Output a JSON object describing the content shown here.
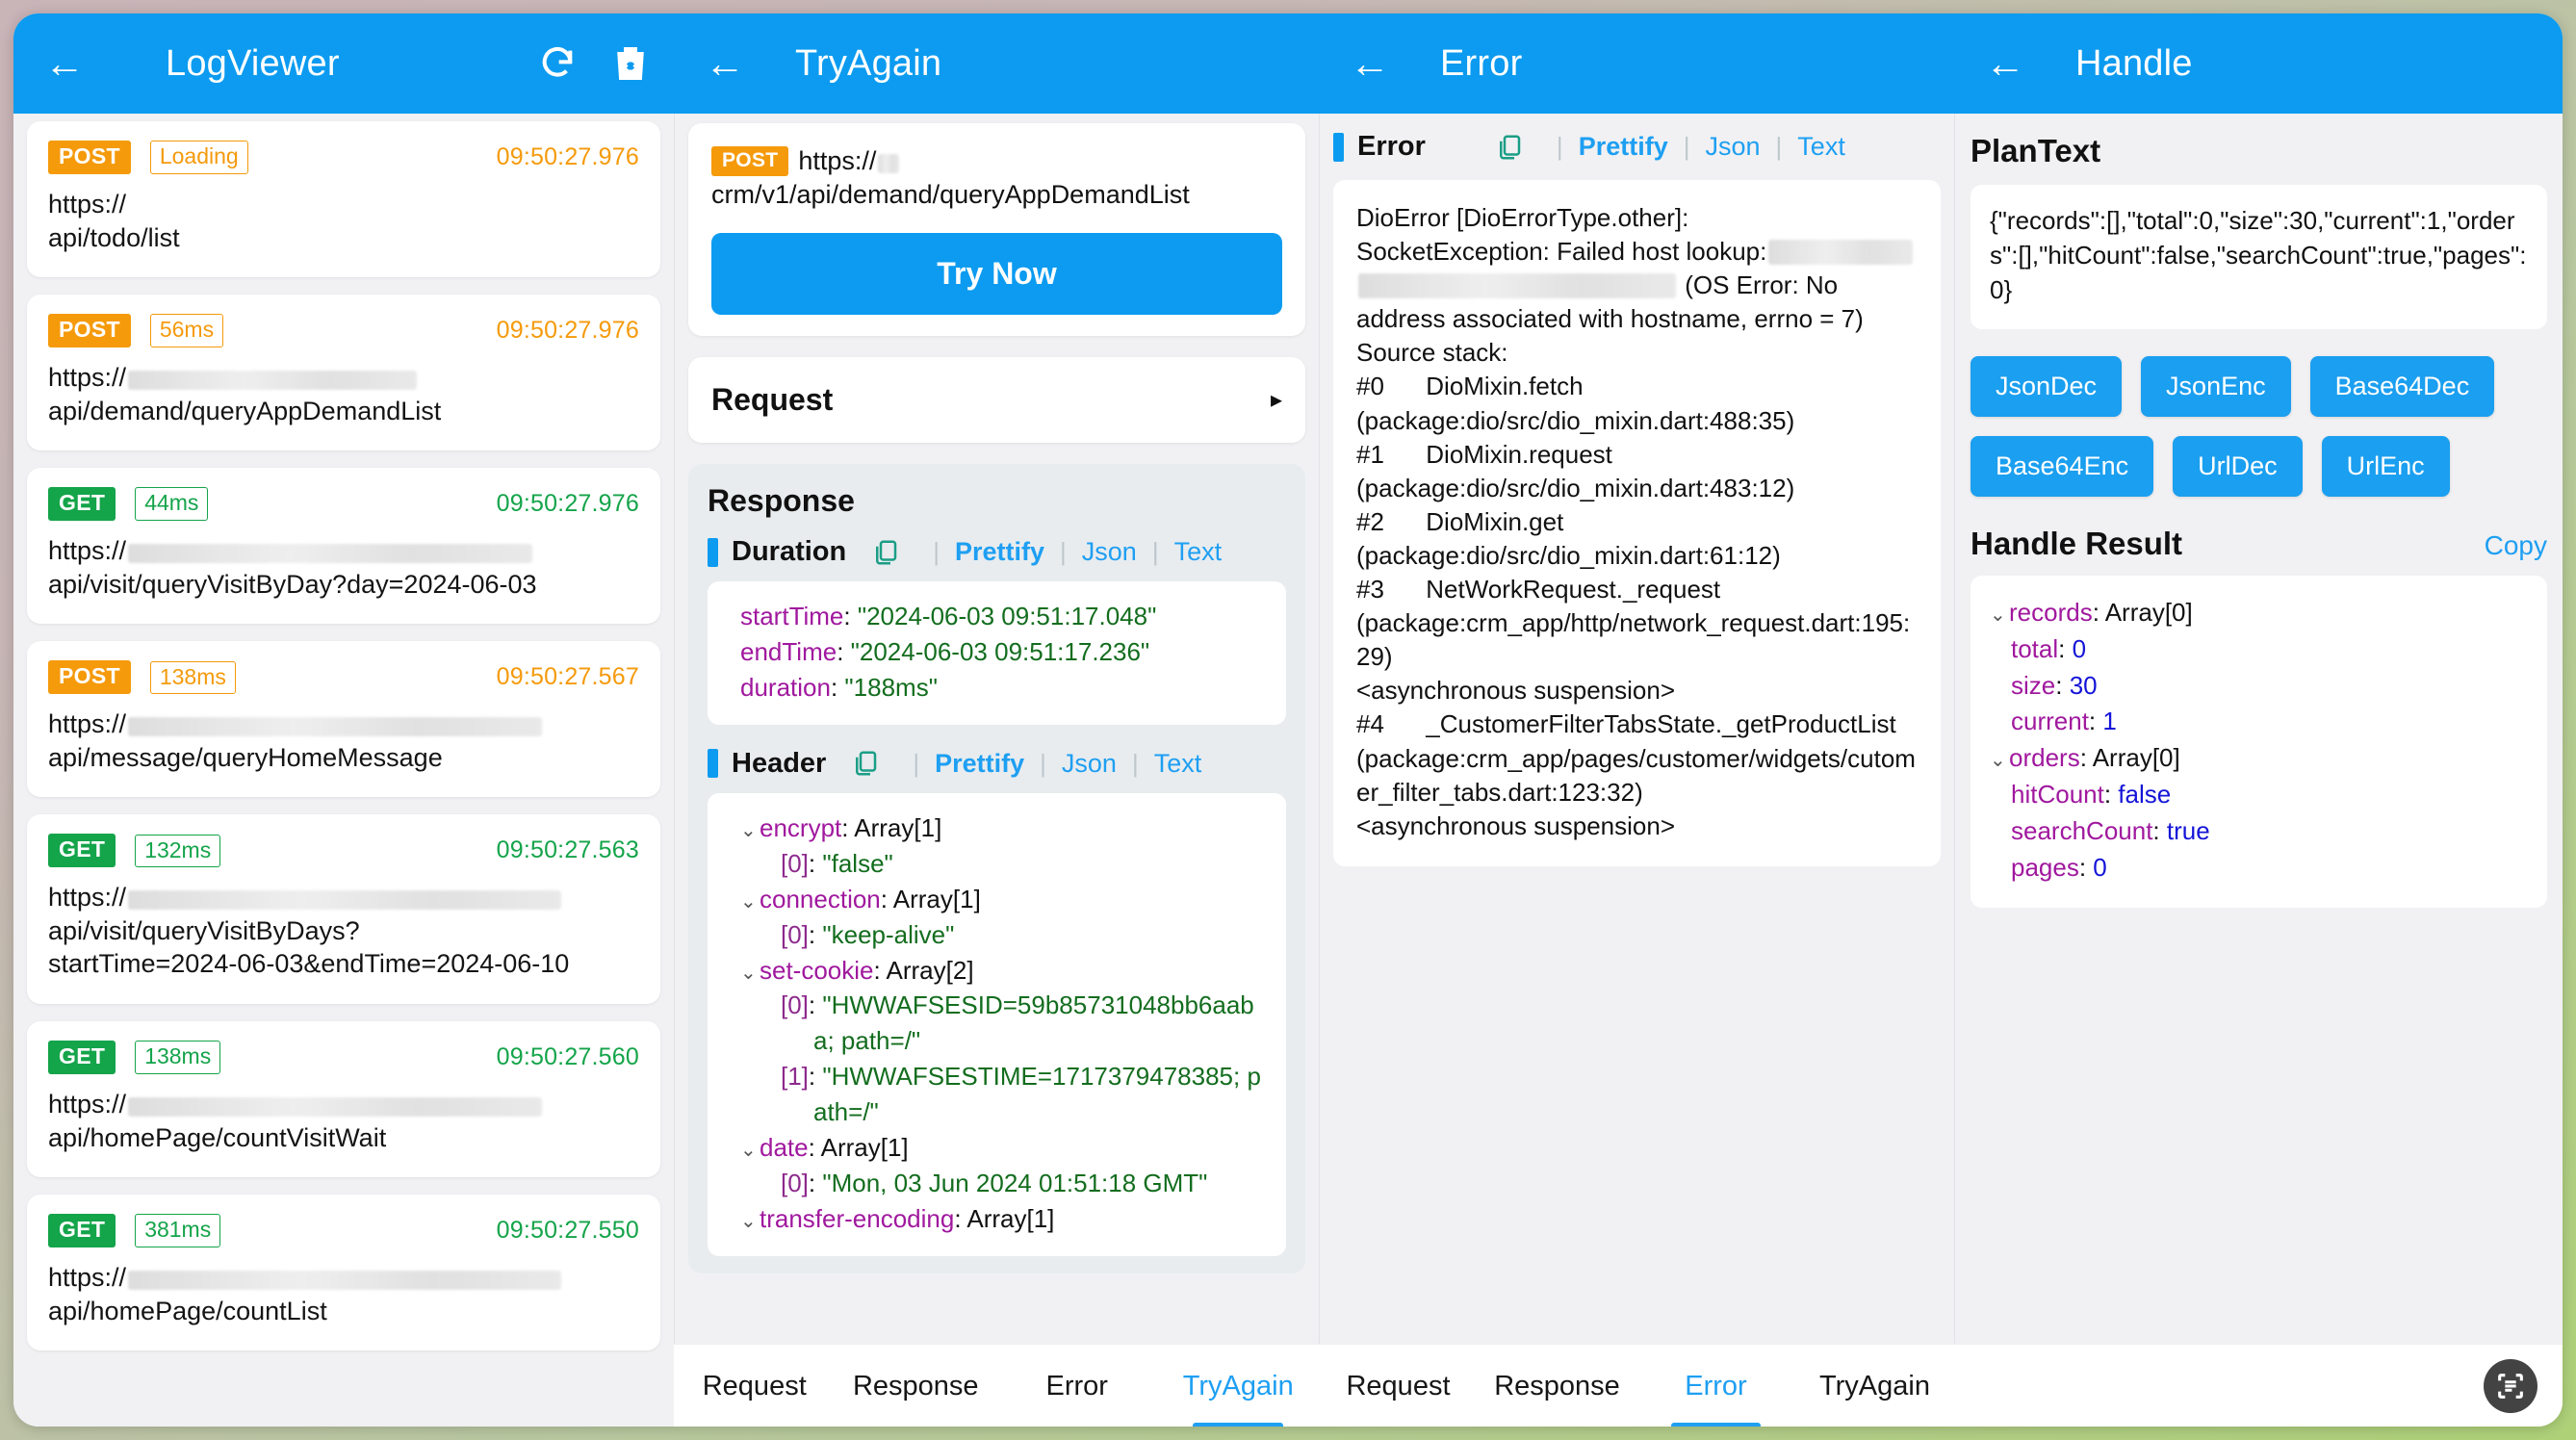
{
  "panels": {
    "logviewer": {
      "title": "LogViewer",
      "back_icon": "back-arrow-icon",
      "refresh_icon": "refresh-icon",
      "delete_icon": "delete-icon",
      "logs": [
        {
          "method": "POST",
          "kind": "post",
          "chip": "Loading",
          "time": "09:50:27.976",
          "url_prefix": "https://",
          "redact_w": 0,
          "url_rest": "api/todo/list",
          "lines": [
            "https://",
            "api/todo/list"
          ]
        },
        {
          "method": "POST",
          "kind": "post",
          "chip": "56ms",
          "time": "09:50:27.976",
          "url_prefix": "https://",
          "redact_w": 300,
          "url_rest": "api/demand/queryAppDemandList",
          "lines": [
            "https://",
            "api/demand/queryAppDemandList"
          ]
        },
        {
          "method": "GET",
          "kind": "get",
          "chip": "44ms",
          "time": "09:50:27.976",
          "url_prefix": "https://",
          "redact_w": 420,
          "url_rest": "api/visit/queryVisitByDay?day=2024-06-03",
          "lines": [
            "https://",
            "api/visit/queryVisitByDay?day=2024-06-03"
          ]
        },
        {
          "method": "POST",
          "kind": "post",
          "chip": "138ms",
          "time": "09:50:27.567",
          "url_prefix": "https://",
          "redact_w": 430,
          "url_rest": "api/message/queryHomeMessage",
          "lines": [
            "https://",
            "api/message/queryHomeMessage"
          ]
        },
        {
          "method": "GET",
          "kind": "get",
          "chip": "132ms",
          "time": "09:50:27.563",
          "url_prefix": "https://",
          "redact_w": 450,
          "url_rest": "api/visit/queryVisitByDays?startTime=2024-06-03&endTime=2024-06-10",
          "lines": [
            "https://",
            "api/visit/queryVisitByDays?",
            "startTime=2024-06-03&endTime=2024-06-10"
          ]
        },
        {
          "method": "GET",
          "kind": "get",
          "chip": "138ms",
          "time": "09:50:27.560",
          "url_prefix": "https://",
          "redact_w": 430,
          "url_rest": "api/homePage/countVisitWait",
          "lines": [
            "https://",
            "api/homePage/countVisitWait"
          ]
        },
        {
          "method": "GET",
          "kind": "get",
          "chip": "381ms",
          "time": "09:50:27.550",
          "url_prefix": "https://",
          "redact_w": 450,
          "url_rest": "api/homePage/countList",
          "lines": [
            "https://",
            "api/homePage/countList"
          ]
        }
      ]
    },
    "tryagain": {
      "title": "TryAgain",
      "request_method": "POST",
      "request_url_head": "https://",
      "request_url_tail": "crm/v1/api/demand/queryAppDemandList",
      "try_button": "Try Now",
      "request_row": "Request",
      "response_title": "Response",
      "duration_label": "Duration",
      "header_label": "Header",
      "actions": {
        "prettify": "Prettify",
        "json": "Json",
        "text": "Text"
      },
      "duration": {
        "startTime_key": "startTime",
        "startTime_val": "\"2024-06-03 09:51:17.048\"",
        "endTime_key": "endTime",
        "endTime_val": "\"2024-06-03 09:51:17.236\"",
        "duration_key": "duration",
        "duration_val": "\"188ms\""
      },
      "header_tree": [
        {
          "indent": 0,
          "arrow": true,
          "key": "encrypt",
          "type": "Array<String>[1]"
        },
        {
          "indent": 1,
          "arrow": false,
          "key": "[0]",
          "value": "\"false\""
        },
        {
          "indent": 0,
          "arrow": true,
          "key": "connection",
          "type": "Array<String>[1]"
        },
        {
          "indent": 1,
          "arrow": false,
          "key": "[0]",
          "value": "\"keep-alive\""
        },
        {
          "indent": 0,
          "arrow": true,
          "key": "set-cookie",
          "type": "Array<String>[2]"
        },
        {
          "indent": 1,
          "arrow": false,
          "key": "[0]",
          "value": "\"HWWAFSESID=59b85731048bb6aaba; path=/\""
        },
        {
          "indent": 1,
          "arrow": false,
          "key": "[1]",
          "value": "\"HWWAFSESTIME=1717379478385; path=/\""
        },
        {
          "indent": 0,
          "arrow": true,
          "key": "date",
          "type": "Array<String>[1]"
        },
        {
          "indent": 1,
          "arrow": false,
          "key": "[0]",
          "value": "\"Mon, 03 Jun 2024 01:51:18 GMT\""
        },
        {
          "indent": 0,
          "arrow": true,
          "key": "transfer-encoding",
          "type": "Array<String>[1]"
        }
      ]
    },
    "error": {
      "title": "Error",
      "section_label": "Error",
      "actions": {
        "prettify": "Prettify",
        "json": "Json",
        "text": "Text"
      },
      "text_1": "DioError [DioErrorType.other]:\nSocketException: Failed host lookup:",
      "text_2": "(OS Error: No address associated with hostname, errno = 7)\nSource stack:\n#0      DioMixin.fetch (package:dio/src/dio_mixin.dart:488:35)\n#1      DioMixin.request (package:dio/src/dio_mixin.dart:483:12)\n#2      DioMixin.get (package:dio/src/dio_mixin.dart:61:12)\n#3      NetWorkRequest._request (package:crm_app/http/network_request.dart:195:29)\n<asynchronous suspension>\n#4      _CustomerFilterTabsState._getProductList (package:crm_app/pages/customer/widgets/cutomer_filter_tabs.dart:123:32)\n<asynchronous suspension>"
    },
    "handle": {
      "title": "Handle",
      "plaintext_label": "PlanText",
      "plaintext_value": "{\"records\":[],\"total\":0,\"size\":30,\"current\":1,\"orders\":[],\"hitCount\":false,\"searchCount\":true,\"pages\":0}",
      "buttons": [
        "JsonDec",
        "JsonEnc",
        "Base64Dec",
        "Base64Enc",
        "UrlDec",
        "UrlEnc"
      ],
      "result_label": "Handle Result",
      "copy_label": "Copy",
      "result_tree": [
        {
          "arrow": true,
          "key": "records",
          "type": "Array[0]"
        },
        {
          "arrow": false,
          "key": "total",
          "num": "0"
        },
        {
          "arrow": false,
          "key": "size",
          "num": "30"
        },
        {
          "arrow": false,
          "key": "current",
          "num": "1"
        },
        {
          "arrow": true,
          "key": "orders",
          "type": "Array[0]"
        },
        {
          "arrow": false,
          "key": "hitCount",
          "num": "false"
        },
        {
          "arrow": false,
          "key": "searchCount",
          "num": "true"
        },
        {
          "arrow": false,
          "key": "pages",
          "num": "0"
        }
      ]
    }
  },
  "bottom_tabs": {
    "group_tryagain": [
      {
        "label": "Request",
        "active": false
      },
      {
        "label": "Response",
        "active": false
      },
      {
        "label": "Error",
        "active": false
      },
      {
        "label": "TryAgain",
        "active": true
      }
    ],
    "group_error": [
      {
        "label": "Request",
        "active": false
      },
      {
        "label": "Response",
        "active": false
      },
      {
        "label": "Error",
        "active": true
      },
      {
        "label": "TryAgain",
        "active": false
      }
    ],
    "fab_icon": "scan-document-icon"
  },
  "colors": {
    "appbar": "#0c9bf0",
    "accent": "#1e9ff2",
    "post": "#f59a0b",
    "get": "#14a44a",
    "key": "#a0189e",
    "string": "#136d1e",
    "number": "#1414d8"
  }
}
